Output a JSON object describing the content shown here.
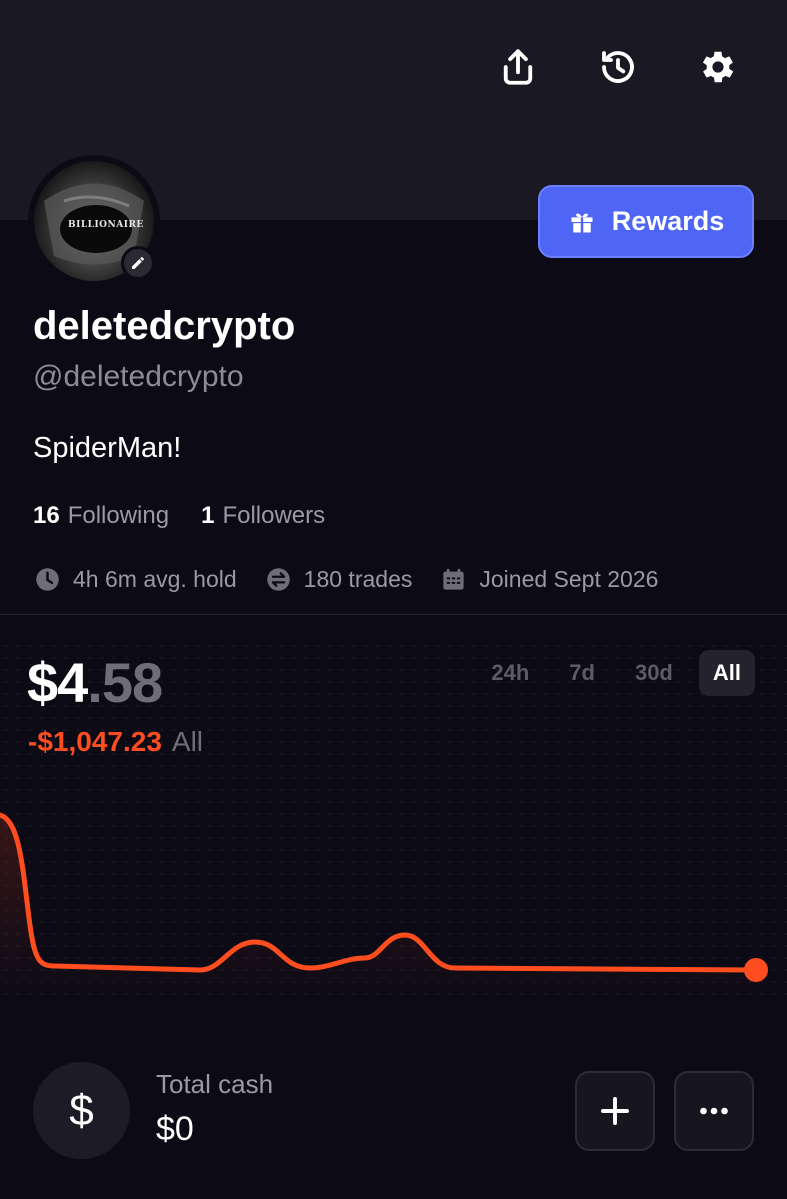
{
  "header": {
    "actions": [
      {
        "icon": "share-icon"
      },
      {
        "icon": "history-icon"
      },
      {
        "icon": "gear-icon"
      }
    ]
  },
  "profile": {
    "avatar_text": "BILLIONAIRE",
    "display_name": "deletedcrypto",
    "handle": "@deletedcrypto",
    "bio": "SpiderMan!",
    "rewards_label": "Rewards",
    "following_count": "16",
    "following_label": "Following",
    "followers_count": "1",
    "followers_label": "Followers",
    "stats": {
      "avg_hold": "4h 6m avg. hold",
      "trades": "180 trades",
      "joined": "Joined Sept 2026"
    }
  },
  "portfolio": {
    "balance_whole": "$4",
    "balance_cents": ".58",
    "pnl_value": "-$1,047.23",
    "pnl_range": "All",
    "range_tabs": [
      "24h",
      "7d",
      "30d",
      "All"
    ],
    "active_range": "All"
  },
  "cash": {
    "icon_glyph": "$",
    "label": "Total cash",
    "value": "$0"
  },
  "colors": {
    "accent": "#4f65f5",
    "loss": "#ff4d1f",
    "background": "#0c0a15"
  }
}
